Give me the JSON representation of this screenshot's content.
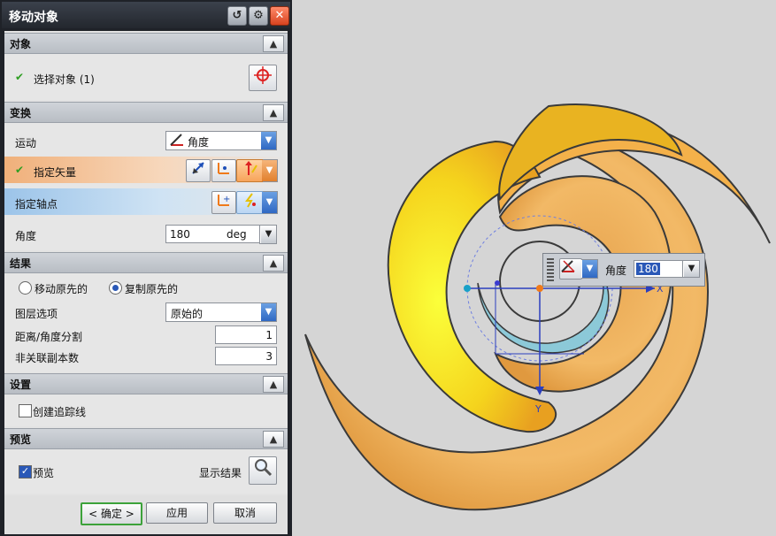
{
  "dialog": {
    "title": "移动对象",
    "title_buttons": [
      "reset",
      "settings",
      "close"
    ]
  },
  "sections": {
    "object": {
      "header": "对象",
      "select_object_label": "选择对象 (1)"
    },
    "transform": {
      "header": "变换",
      "motion_label": "运动",
      "motion_value": "角度",
      "vector_label": "指定矢量",
      "pivot_label": "指定轴点",
      "angle_label": "角度",
      "angle_value": "180",
      "angle_unit": "deg"
    },
    "result": {
      "header": "结果",
      "move_original_label": "移动原先的",
      "copy_original_label": "复制原先的",
      "selected_option": "复制原先的",
      "layer_option_label": "图层选项",
      "layer_option_value": "原始的",
      "distance_split_label": "距离/角度分割",
      "distance_split_value": "1",
      "copies_label": "非关联副本数",
      "copies_value": "3"
    },
    "settings": {
      "header": "设置",
      "create_trace_label": "创建追踪线",
      "create_trace_checked": false
    },
    "preview": {
      "header": "预览",
      "preview_label": "预览",
      "preview_checked": true,
      "show_result_label": "显示结果"
    }
  },
  "footer": {
    "ok_label": "< 确定 >",
    "apply_label": "应用",
    "cancel_label": "取消"
  },
  "float_toolbar": {
    "angle_label": "角度",
    "angle_value": "180"
  },
  "viewport": {
    "axis_x_label": "X",
    "axis_y_label": "Y"
  },
  "colors": {
    "accent_orange": "#f7a45a",
    "accent_blue": "#2f68c3",
    "check_green": "#2e9e22",
    "model_orange": "#f2b35a",
    "model_yellow": "#f5e61a"
  }
}
